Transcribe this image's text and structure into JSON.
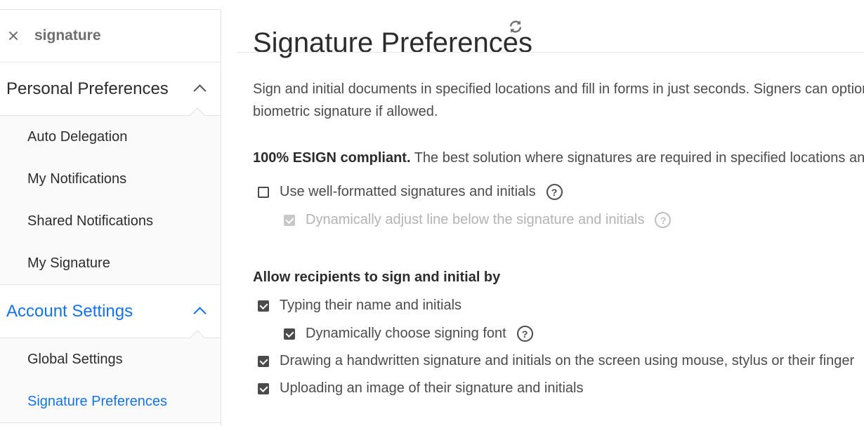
{
  "search": {
    "value": "signature",
    "close_icon": "close-icon"
  },
  "sidebar": {
    "personal": {
      "title": "Personal Preferences",
      "items": [
        {
          "label": "Auto Delegation"
        },
        {
          "label": "My Notifications"
        },
        {
          "label": "Shared Notifications"
        },
        {
          "label": "My Signature"
        }
      ]
    },
    "account": {
      "title": "Account Settings",
      "items": [
        {
          "label": "Global Settings"
        },
        {
          "label": "Signature Preferences",
          "active": true
        }
      ]
    }
  },
  "main": {
    "title": "Signature Preferences",
    "intro_line1": "Sign and initial documents in specified locations and fill in forms in just seconds. Signers can optiona",
    "intro_line2": "biometric signature if allowed.",
    "esign_bold": "100% ESIGN compliant.",
    "esign_rest": " The best solution where signatures are required in specified locations and p",
    "opt_well_formatted": "Use well-formatted signatures and initials",
    "opt_dynamic_line": "Dynamically adjust line below the signature and initials",
    "allow_heading": "Allow recipients to sign and initial by",
    "opt_typing": "Typing their name and initials",
    "opt_font": "Dynamically choose signing font",
    "opt_drawing": "Drawing a handwritten signature and initials on the screen using mouse, stylus or their finger",
    "opt_uploading": "Uploading an image of their signature and initials",
    "help_glyph": "?"
  },
  "colors": {
    "accent": "#1473e6",
    "text": "#2c2c2c",
    "muted": "#b3b3b3"
  }
}
